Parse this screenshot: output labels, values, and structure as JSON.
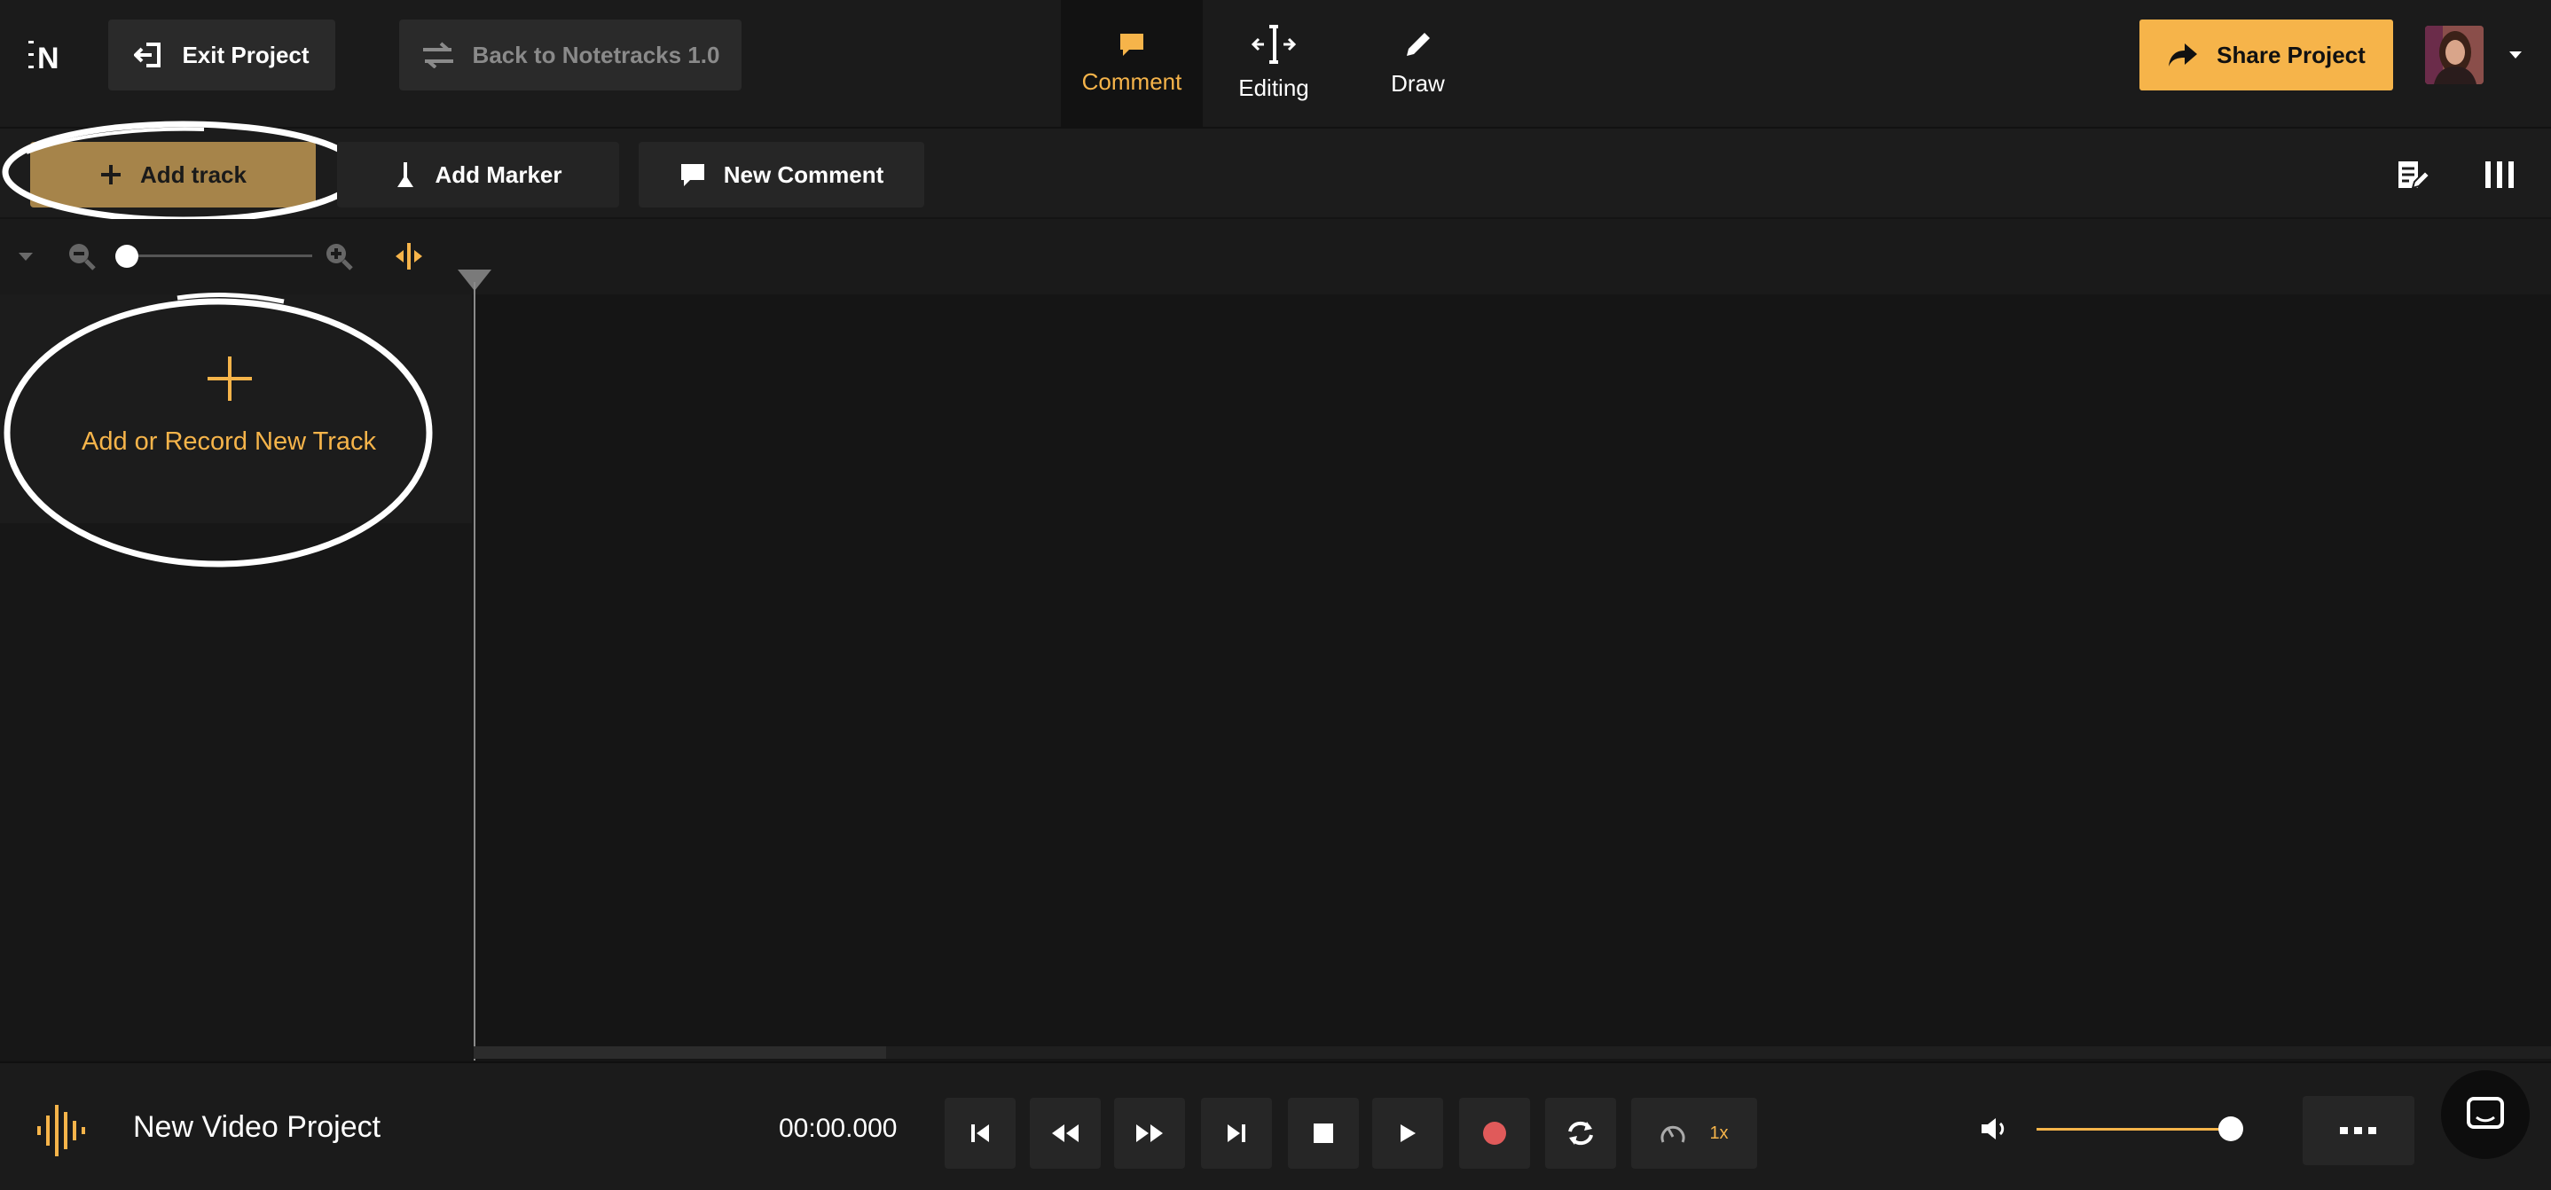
{
  "app": {
    "logo_letter": "N",
    "exit_label": "Exit Project",
    "back_label": "Back to Notetracks 1.0",
    "share_label": "Share Project"
  },
  "tabs": [
    {
      "label": "Comment",
      "icon": "comment-icon",
      "active": true
    },
    {
      "label": "Editing",
      "icon": "editing-icon",
      "active": false
    },
    {
      "label": "Draw",
      "icon": "pencil-icon",
      "active": false
    }
  ],
  "toolbar": {
    "add_track_label": "Add track",
    "add_marker_label": "Add Marker",
    "new_comment_label": "New Comment"
  },
  "sidebar": {
    "add_record_label": "Add or Record New Track"
  },
  "transport": {
    "project_name": "New Video Project",
    "time": "00:00.000",
    "speed_label": "1x",
    "volume_fraction": 0.97
  },
  "colors": {
    "accent": "#f6b44a",
    "record": "#e05a5a",
    "background": "#161616"
  }
}
